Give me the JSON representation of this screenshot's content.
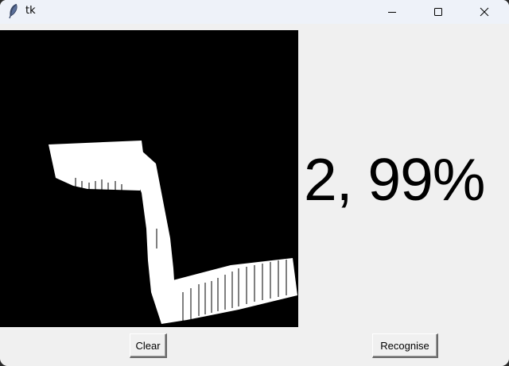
{
  "window": {
    "title": "tk"
  },
  "canvas": {
    "background": "#000000",
    "stroke_color": "#ffffff"
  },
  "result": {
    "text": "2, 99%"
  },
  "buttons": {
    "clear_label": "Clear",
    "recognise_label": "Recognise"
  }
}
